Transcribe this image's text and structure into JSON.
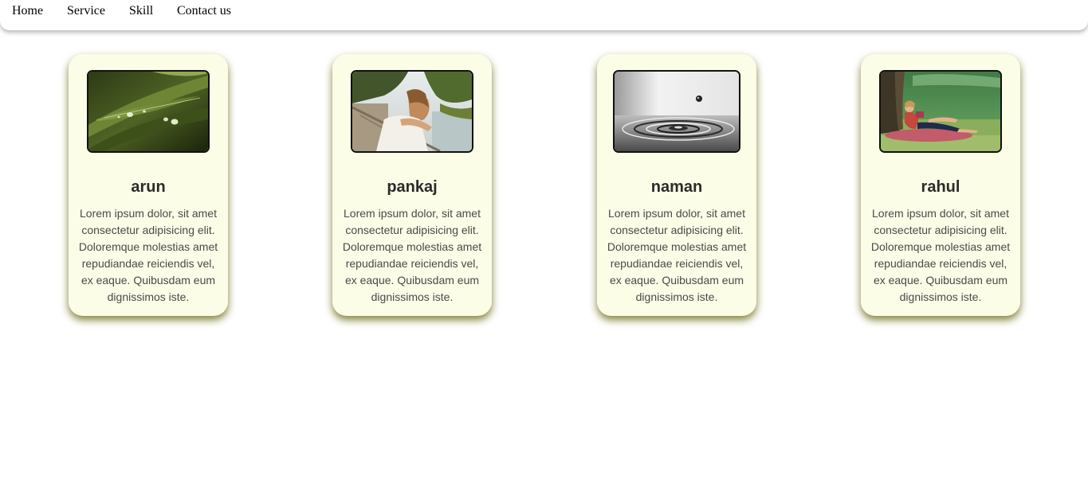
{
  "nav": {
    "items": [
      {
        "label": "Home"
      },
      {
        "label": "Service"
      },
      {
        "label": "Skill"
      },
      {
        "label": "Contact us"
      }
    ]
  },
  "cards": [
    {
      "name": "arun",
      "photo": "leaf-with-water-drops-photo",
      "text": "Lorem ipsum dolor, sit amet consectetur adipisicing elit. Doloremque molestias amet repudiandae reiciendis vel, ex eaque. Quibusdam eum dignissimos iste."
    },
    {
      "name": "pankaj",
      "photo": "woman-leaning-on-railing-photo",
      "text": "Lorem ipsum dolor, sit amet consectetur adipisicing elit. Doloremque molestias amet repudiandae reiciendis vel, ex eaque. Quibusdam eum dignissimos iste."
    },
    {
      "name": "naman",
      "photo": "water-drop-ripple-photo",
      "text": "Lorem ipsum dolor, sit amet consectetur adipisicing elit. Doloremque molestias amet repudiandae reiciendis vel, ex eaque. Quibusdam eum dignissimos iste."
    },
    {
      "name": "rahul",
      "photo": "woman-reading-in-park-photo",
      "text": "Lorem ipsum dolor, sit amet consectetur adipisicing elit. Doloremque molestias amet repudiandae reiciendis vel, ex eaque. Quibusdam eum dignissimos iste."
    }
  ],
  "colors": {
    "card_background": "#fbfde6",
    "card_shadow": "#6e6e19",
    "heading_text": "#2b2b2b",
    "body_text": "#4a4a4a"
  }
}
